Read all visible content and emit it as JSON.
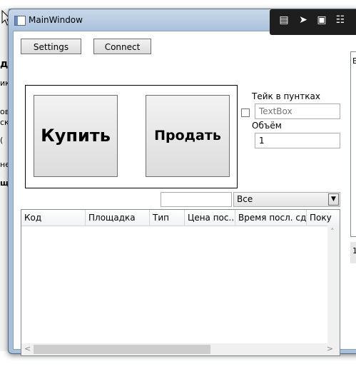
{
  "background": {
    "left_panel_texts": [
      "д",
      "ик",
      "ов",
      "ск",
      "(",
      "не",
      "щ"
    ]
  },
  "window": {
    "title": "MainWindow"
  },
  "toolbar": {
    "settings_label": "Settings",
    "connect_label": "Connect"
  },
  "trade": {
    "buy_label": "Купить",
    "sell_label": "Продать"
  },
  "options": {
    "take_label": "Тейк в пунтках",
    "take_placeholder": "TextBox",
    "volume_label": "Объём",
    "volume_value": "1"
  },
  "filter": {
    "search_value": "",
    "combo_value": "Все"
  },
  "grid": {
    "columns": [
      "Код",
      "Площадка",
      "Тип",
      "Цена пос...",
      "Время посл. сд...",
      "Поку"
    ]
  },
  "right_panel": {
    "header_text": "Вз",
    "footer_text": "1"
  }
}
